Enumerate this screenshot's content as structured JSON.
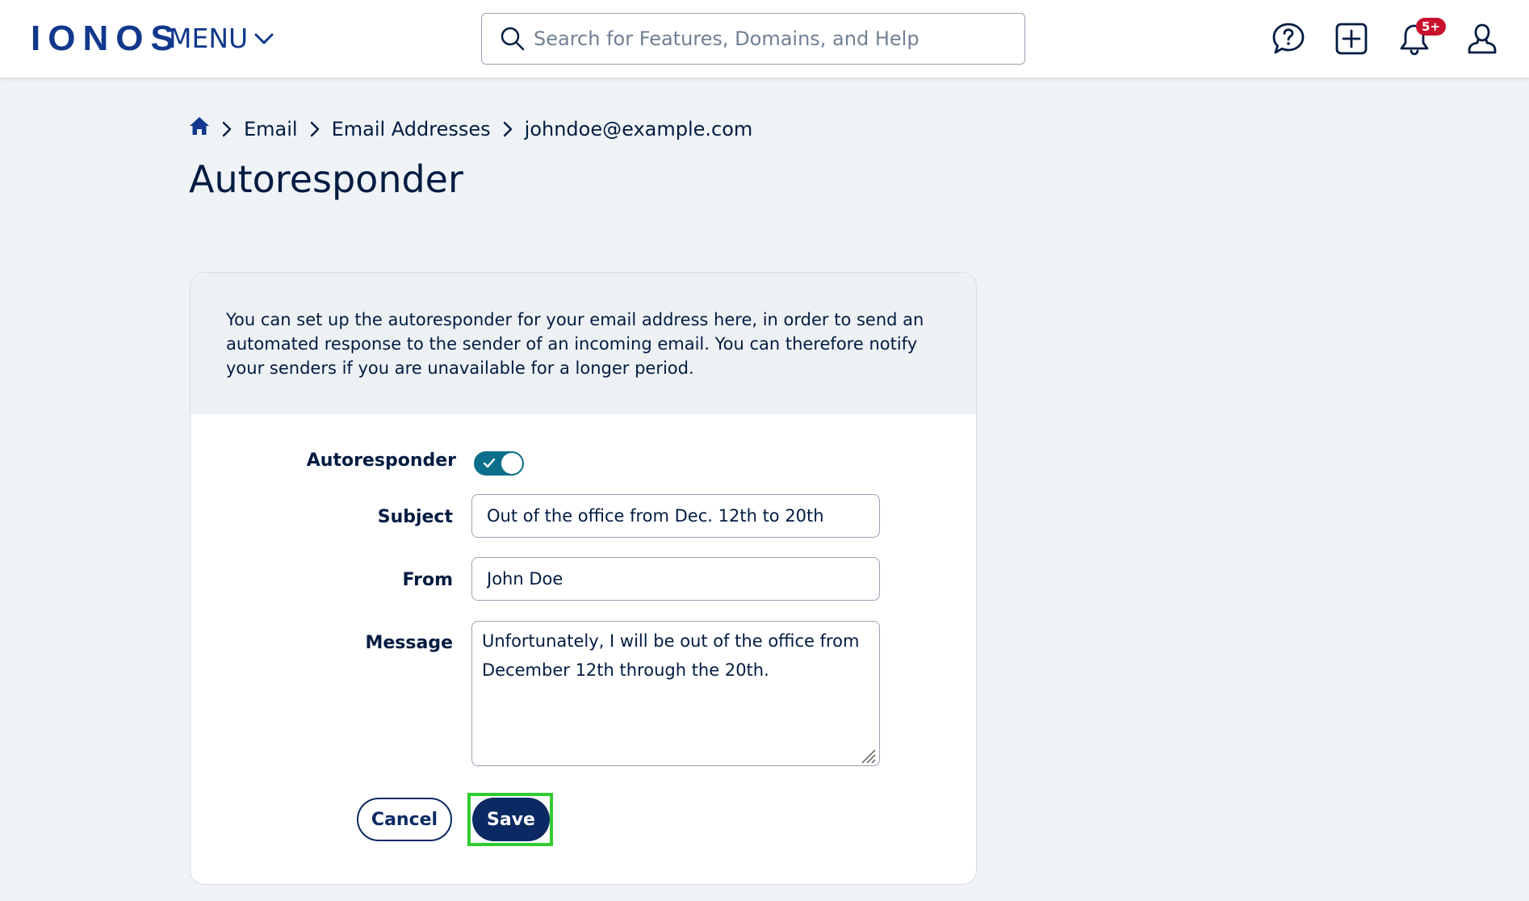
{
  "header": {
    "logo": "IONOS",
    "menu_label": "MENU",
    "search_placeholder": "Search for Features, Domains, and Help",
    "notification_badge": "5+",
    "icons": [
      "help-icon",
      "add-icon",
      "bell-icon",
      "user-icon"
    ]
  },
  "breadcrumb": {
    "items": [
      "Email",
      "Email Addresses",
      "johndoe@example.com"
    ]
  },
  "page": {
    "title": "Autoresponder"
  },
  "card": {
    "intro": "You can set up the autoresponder for your email address here, in order to send an automated response to the sender of an incoming email. You can therefore notify your senders if you are unavailable for a longer period.",
    "form": {
      "autoresponder_label": "Autoresponder",
      "autoresponder_enabled": true,
      "subject_label": "Subject",
      "subject_value": "Out of the office from Dec. 12th to 20th",
      "from_label": "From",
      "from_value": "John Doe",
      "message_label": "Message",
      "message_value": "Unfortunately, I will be out of the office from December 12th through the 20th."
    },
    "buttons": {
      "cancel_label": "Cancel",
      "save_label": "Save"
    }
  },
  "colors": {
    "brand": "#11388c",
    "primary_button": "#0b2a63",
    "toggle_on": "#0b6e8a",
    "badge": "#c8102e",
    "highlight": "#2ecc2e",
    "background": "#f0f3f6"
  }
}
